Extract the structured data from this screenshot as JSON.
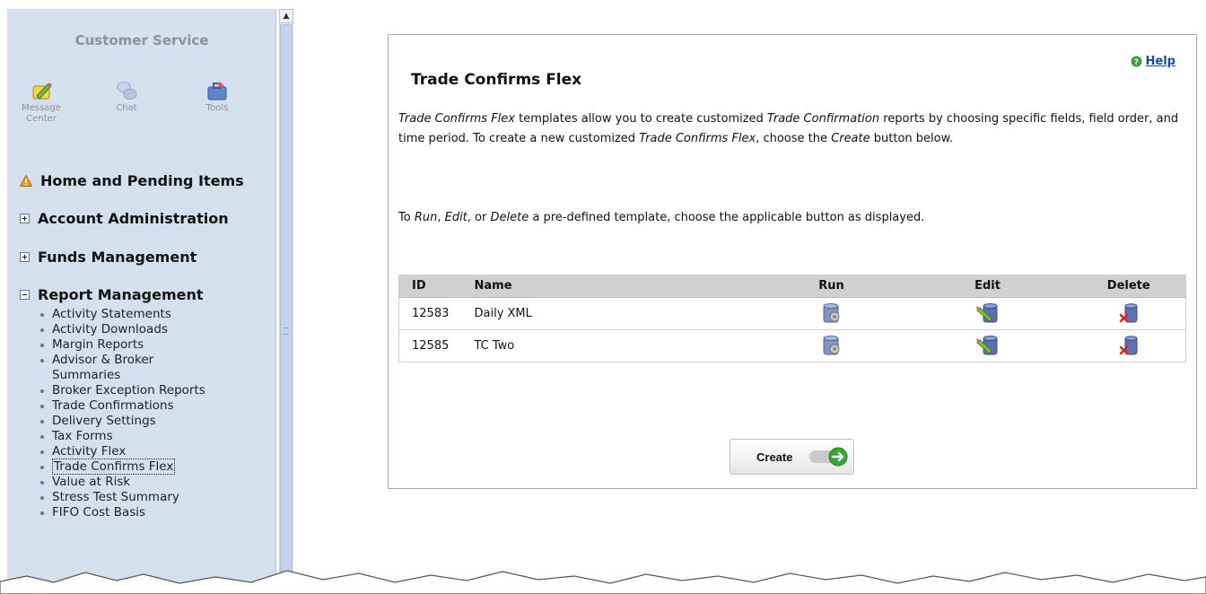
{
  "sidebar": {
    "title": "Customer Service",
    "quick_icons": [
      {
        "label_line1": "Message",
        "label_line2": "Center",
        "icon": "message-center-icon"
      },
      {
        "label_line1": "Chat",
        "icon": "chat-icon"
      },
      {
        "label_line1": "Tools",
        "icon": "tools-icon"
      }
    ],
    "nav": [
      {
        "label": "Home and Pending Items",
        "marker": "warning-icon"
      },
      {
        "label": "Account Administration",
        "marker": "expand-icon"
      },
      {
        "label": "Funds Management",
        "marker": "expand-icon"
      },
      {
        "label": "Report Management",
        "marker": "collapse-icon"
      }
    ],
    "report_items": [
      "Activity Statements",
      "Activity Downloads",
      "Margin Reports",
      "Advisor & Broker Summaries",
      "Broker Exception Reports",
      "Trade Confirmations",
      "Delivery Settings",
      "Tax Forms",
      "Activity Flex",
      "Trade Confirms Flex",
      "Value at Risk",
      "Stress Test Summary",
      "FIFO Cost Basis"
    ],
    "active_item": "Trade Confirms Flex"
  },
  "main": {
    "help_label": "Help",
    "title": "Trade Confirms Flex",
    "p1": {
      "a": "Trade Confirms Flex",
      "b": " templates allow you to create customized ",
      "c": "Trade Confirmation",
      "d": " reports by choosing specific fields, field order, and time period. To create a new customized ",
      "e": "Trade Confirms Flex",
      "f": ", choose the ",
      "g": "Create",
      "h": " button below."
    },
    "p2": {
      "a": "To ",
      "b": "Run",
      "c": ", ",
      "d": "Edit",
      "e": ", or ",
      "f": "Delete",
      "g": " a pre-defined template, choose the applicable button as displayed."
    },
    "table": {
      "headers": {
        "id": "ID",
        "name": "Name",
        "run": "Run",
        "edit": "Edit",
        "delete": "Delete"
      },
      "rows": [
        {
          "id": "12583",
          "name": "Daily XML"
        },
        {
          "id": "12585",
          "name": "TC Two"
        }
      ]
    },
    "create_label": "Create"
  },
  "colors": {
    "sidebar_bg": "#d5e0ef",
    "link": "#0b4ea2",
    "table_header_bg": "#d0d0d0",
    "create_arrow": "#3aa535"
  }
}
